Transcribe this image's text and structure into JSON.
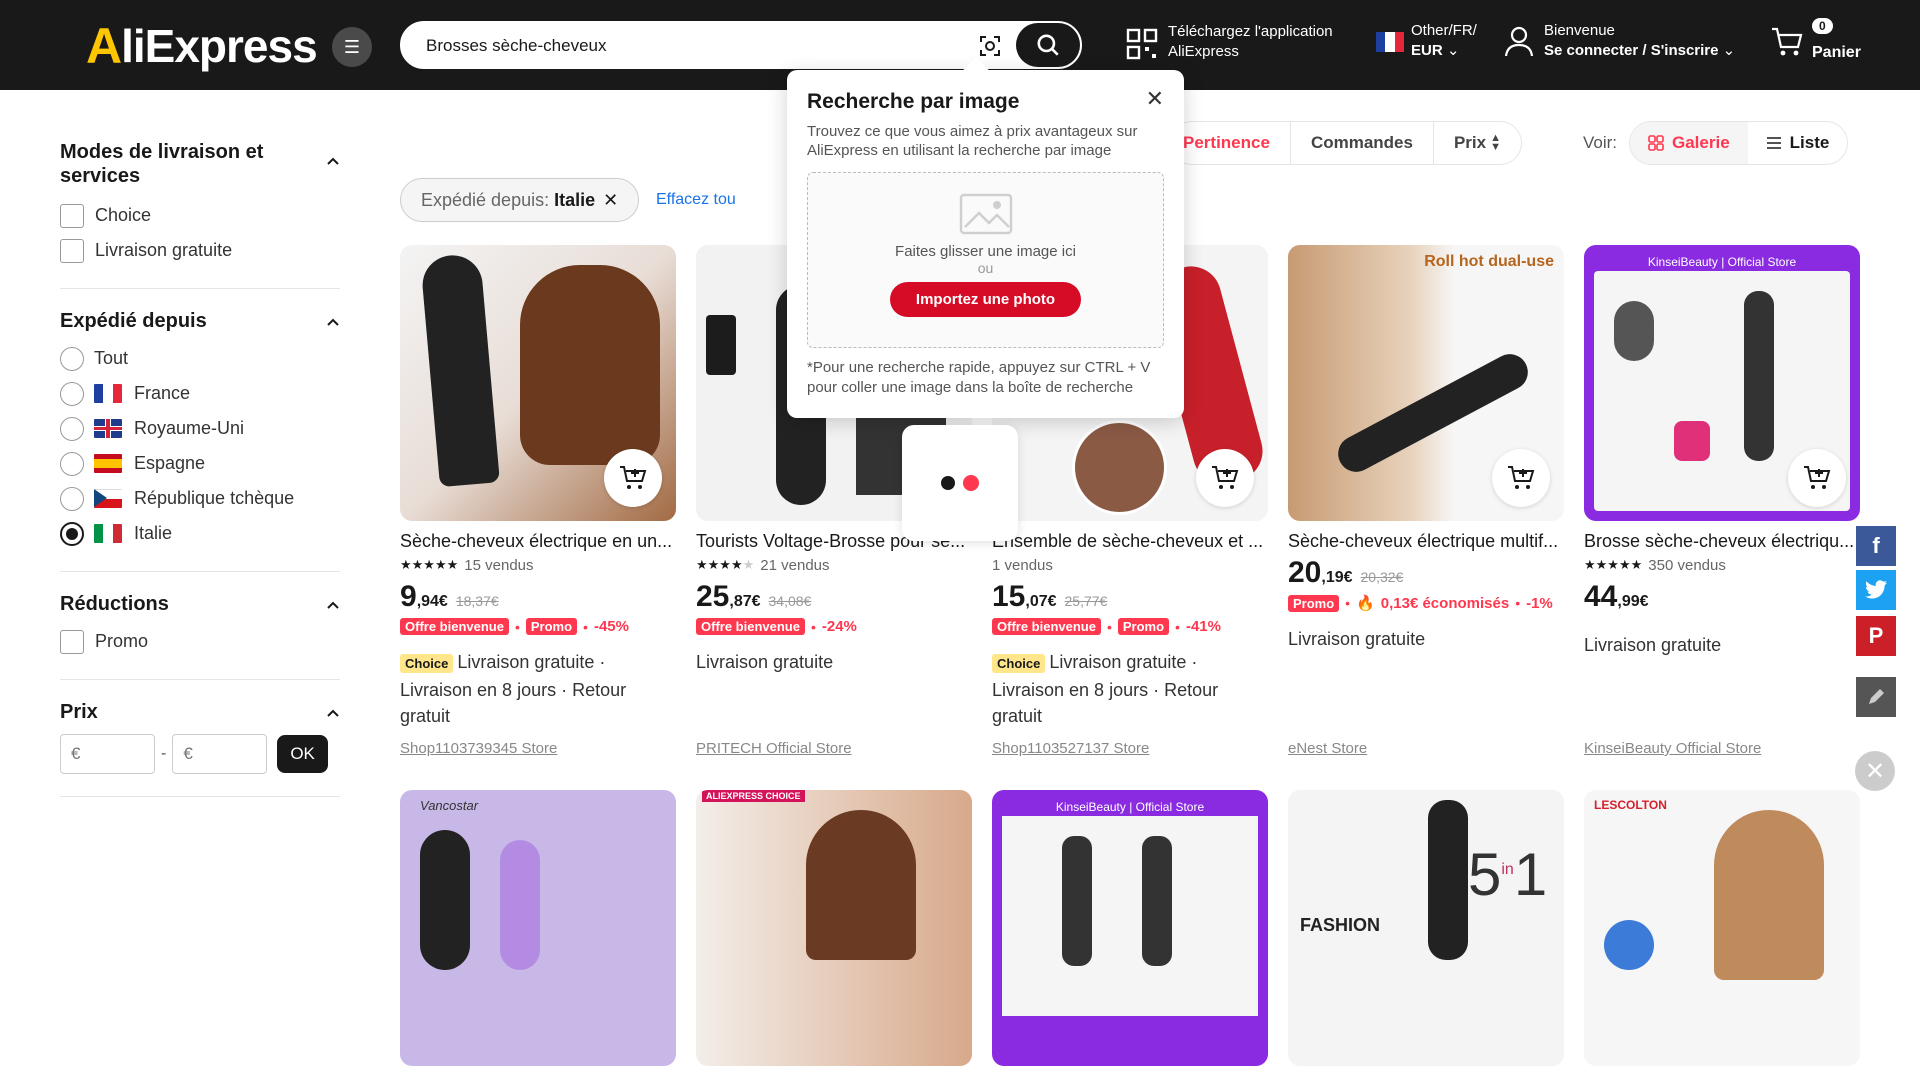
{
  "header": {
    "logo": "AliExpress",
    "search_value": "Brosses sèche-cheveux",
    "app_line1": "Téléchargez l'application",
    "app_line2": "AliExpress",
    "locale_line1": "Other/FR/",
    "locale_line2": "EUR",
    "account_line1": "Bienvenue",
    "account_line2": "Se connecter / S'inscrire",
    "cart_count": "0",
    "cart_label": "Panier"
  },
  "sidebar": {
    "delivery_title": "Modes de livraison et services",
    "delivery_options": [
      "Choice",
      "Livraison gratuite"
    ],
    "shipped_title": "Expédié depuis",
    "shipped_options": [
      "Tout",
      "France",
      "Royaume-Uni",
      "Espagne",
      "République tchèque",
      "Italie"
    ],
    "reductions_title": "Réductions",
    "reductions_options": [
      "Promo"
    ],
    "price_title": "Prix",
    "price_min_placeholder": "€",
    "price_max_placeholder": "€",
    "price_sep": "-",
    "ok_label": "OK"
  },
  "sort": {
    "relevance": "Pertinence",
    "orders": "Commandes",
    "price": "Prix",
    "view_label": "Voir:",
    "gallery": "Galerie",
    "list": "Liste"
  },
  "filter_chip": {
    "label": "Expédié depuis:",
    "value": "Italie",
    "clear_all": "Effacez tou"
  },
  "products": [
    {
      "title": "Sèche-cheveux électrique en un...",
      "sold": "15 vendus",
      "price_int": "9",
      "price_dec": ",94€",
      "old": "18,37€",
      "badge1": "Offre bienvenue",
      "badge2": "Promo",
      "pct": "-45%",
      "choice": "Choice",
      "ship": "Livraison gratuite · Livraison en 8 jours · Retour gratuit",
      "store": "Shop1103739345 Store"
    },
    {
      "title": "Tourists Voltage-Brosse pour sè...",
      "sold": "21 vendus",
      "price_int": "25",
      "price_dec": ",87€",
      "old": "34,08€",
      "badge1": "Offre bienvenue",
      "pct": "-24%",
      "ship": "Livraison gratuite",
      "store": "PRITECH Official Store"
    },
    {
      "title": "Ensemble de sèche-cheveux et ...",
      "sold": "1 vendus",
      "price_int": "15",
      "price_dec": ",07€",
      "old": "25,77€",
      "badge1": "Offre bienvenue",
      "badge2": "Promo",
      "pct": "-41%",
      "choice": "Choice",
      "ship": "Livraison gratuite · Livraison en 8 jours · Retour gratuit",
      "store": "Shop1103527137 Store"
    },
    {
      "title": "Sèche-cheveux électrique multif...",
      "price_int": "20",
      "price_dec": ",19€",
      "old": "20,32€",
      "badge2": "Promo",
      "saved": "0,13€ économisés",
      "pct": "-1%",
      "ship": "Livraison gratuite",
      "store": "eNest Store",
      "img_text": "Roll hot dual-use"
    },
    {
      "title": "Brosse sèche-cheveux électriqu...",
      "sold": "350 vendus",
      "price_int": "44",
      "price_dec": ",99€",
      "ship": "Livraison gratuite",
      "store": "KinseiBeauty Official Store",
      "img_text": "KinseiBeauty | Official Store"
    }
  ],
  "row2": [
    {
      "img_text": "Vancostar"
    },
    {
      "img_text": "ALIEXPRESS CHOICE"
    },
    {
      "img_text": "KinseiBeauty | Official Store"
    },
    {
      "img_text": "FASHION"
    },
    {
      "img_text": "LESCOLTON"
    }
  ],
  "popup": {
    "title": "Recherche par image",
    "subtitle": "Trouvez ce que vous aimez à prix avantageux sur AliExpress en utilisant la recherche par image",
    "drop_text": "Faites glisser une image ici",
    "or": "ou",
    "upload": "Importez une photo",
    "note": "*Pour une recherche rapide, appuyez sur CTRL + V pour coller une image dans la boîte de recherche"
  },
  "colors": {
    "accent": "#fd384f",
    "header_bg": "#191919",
    "upload_btn": "#d60b26"
  }
}
